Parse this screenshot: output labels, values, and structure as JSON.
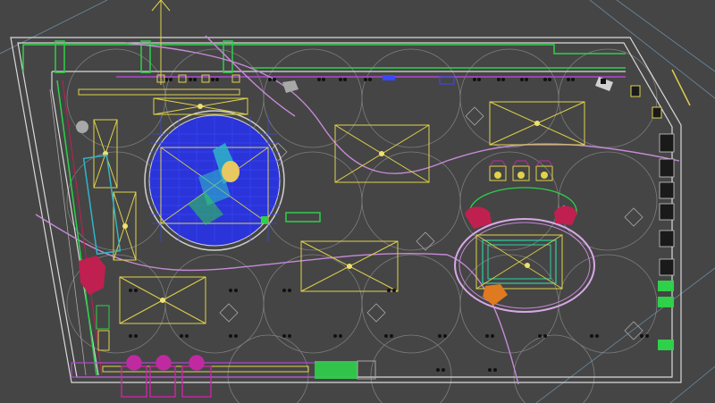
{
  "viewport": {
    "view": "Top",
    "background": "#454545"
  },
  "colors": {
    "wall": "#d9d9d9",
    "curve": "#c58ad6",
    "ceiling_grid": "#9a9a9a",
    "light_panel": "#e0d24a",
    "dome": "#2a34d8",
    "dome_grid": "#3a48ff",
    "dome_ring": "#d0d0d0",
    "accent_green": "#2fd04a",
    "accent_cyan": "#2fb5c8",
    "accent_magenta": "#c02aa0",
    "accent_red": "#c02050",
    "accent_orange": "#e07a20",
    "light_fixture": "#111111"
  },
  "objects": [
    {
      "name": "outer-wall",
      "kind": "wall"
    },
    {
      "name": "circular-dome",
      "kind": "ceiling-feature"
    },
    {
      "name": "oval-booth",
      "kind": "display"
    },
    {
      "name": "rect-light-panels",
      "kind": "lighting",
      "count": 8
    },
    {
      "name": "spotlight-fixtures",
      "kind": "lighting"
    },
    {
      "name": "curved-path",
      "kind": "floor-line"
    },
    {
      "name": "magenta-chairs",
      "kind": "furniture",
      "count": 4
    },
    {
      "name": "right-wall-plants",
      "kind": "decor",
      "count": 8
    }
  ]
}
